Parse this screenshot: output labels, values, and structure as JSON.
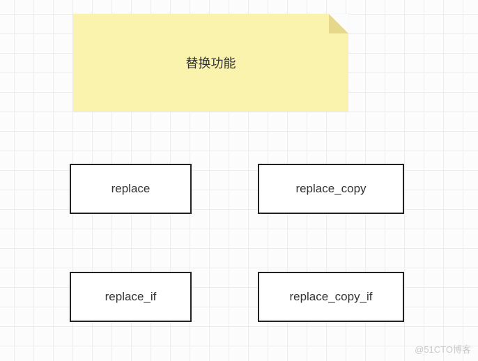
{
  "note": {
    "title": "替换功能"
  },
  "boxes": {
    "b1": "replace",
    "b2": "replace_copy",
    "b3": "replace_if",
    "b4": "replace_copy_if"
  },
  "watermark": "@51CTO博客"
}
